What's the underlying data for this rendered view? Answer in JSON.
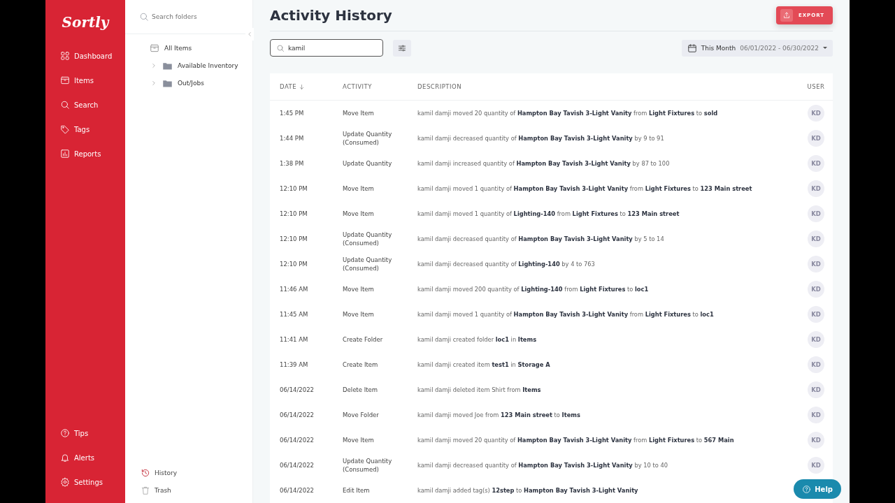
{
  "sidebar": {
    "logo": "Sortly",
    "nav": [
      {
        "label": "Dashboard"
      },
      {
        "label": "Items"
      },
      {
        "label": "Search"
      },
      {
        "label": "Tags"
      },
      {
        "label": "Reports"
      }
    ],
    "bottom_nav": [
      {
        "label": "Tips"
      },
      {
        "label": "Alerts"
      },
      {
        "label": "Settings"
      }
    ]
  },
  "folders": {
    "search": {
      "placeholder": "Search folders"
    },
    "root": {
      "label": "All Items",
      "children": [
        {
          "label": "Available Inventory",
          "expanded": false
        },
        {
          "label": "Out/Jobs",
          "expanded": false
        }
      ]
    },
    "bottom_links": [
      {
        "label": "History",
        "selected": true
      },
      {
        "label": "Trash",
        "selected": false
      }
    ]
  },
  "page": {
    "title": "Activity History",
    "export_button": "EXPORT",
    "search": {
      "value": "kamil"
    },
    "date_range": {
      "label": "This Month",
      "range": "06/01/2022 - 06/30/2022"
    }
  },
  "table": {
    "columns": [
      "DATE",
      "ACTIVITY",
      "DESCRIPTION",
      "USER"
    ],
    "rows": [
      {
        "date": "1:45 PM",
        "activity": "Move Item",
        "description": "kamil damji moved 20 quantity of **Hampton Bay Tavish 3-Light Vanity** from **Light Fixtures** to **sold**",
        "user": "KD"
      },
      {
        "date": "1:44 PM",
        "activity": "Update Quantity (Consumed)",
        "description": "kamil damji decreased quantity of **Hampton Bay Tavish 3-Light Vanity** by 9 to 91",
        "user": "KD"
      },
      {
        "date": "1:38 PM",
        "activity": "Update Quantity",
        "description": "kamil damji increased quantity of **Hampton Bay Tavish 3-Light Vanity** by 87 to 100",
        "user": "KD"
      },
      {
        "date": "12:10 PM",
        "activity": "Move Item",
        "description": "kamil damji moved 1 quantity of **Hampton Bay Tavish 3-Light Vanity** from **Light Fixtures** to **123 Main street**",
        "user": "KD"
      },
      {
        "date": "12:10 PM",
        "activity": "Move Item",
        "description": "kamil damji moved 1 quantity of **Lighting-140** from **Light Fixtures** to **123 Main street**",
        "user": "KD"
      },
      {
        "date": "12:10 PM",
        "activity": "Update Quantity (Consumed)",
        "description": "kamil damji decreased quantity of **Hampton Bay Tavish 3-Light Vanity** by 5 to 14",
        "user": "KD"
      },
      {
        "date": "12:10 PM",
        "activity": "Update Quantity (Consumed)",
        "description": "kamil damji decreased quantity of **Lighting-140** by 4 to 763",
        "user": "KD"
      },
      {
        "date": "11:46 AM",
        "activity": "Move Item",
        "description": "kamil damji moved 200 quantity of **Lighting-140** from **Light Fixtures** to **loc1**",
        "user": "KD"
      },
      {
        "date": "11:45 AM",
        "activity": "Move Item",
        "description": "kamil damji moved 1 quantity of **Hampton Bay Tavish 3-Light Vanity** from **Light Fixtures** to **loc1**",
        "user": "KD"
      },
      {
        "date": "11:41 AM",
        "activity": "Create Folder",
        "description": "kamil damji created folder **loc1** in **Items**",
        "user": "KD"
      },
      {
        "date": "11:39 AM",
        "activity": "Create Item",
        "description": "kamil damji created item **test1** in **Storage A**",
        "user": "KD"
      },
      {
        "date": "06/14/2022",
        "activity": "Delete Item",
        "description": "kamil damji deleted item Shirt from **Items**",
        "user": "KD"
      },
      {
        "date": "06/14/2022",
        "activity": "Move Folder",
        "description": "kamil damji moved Joe from **123 Main street** to **Items**",
        "user": "KD"
      },
      {
        "date": "06/14/2022",
        "activity": "Move Item",
        "description": "kamil damji moved 20 quantity of **Hampton Bay Tavish 3-Light Vanity** from **Light Fixtures** to **567 Main**",
        "user": "KD"
      },
      {
        "date": "06/14/2022",
        "activity": "Update Quantity (Consumed)",
        "description": "kamil damji decreased quantity of **Hampton Bay Tavish 3-Light Vanity** by 10 to 40",
        "user": "KD"
      },
      {
        "date": "06/14/2022",
        "activity": "Edit Item",
        "description": "kamil damji added tag(s) **12step** to **Hampton Bay Tavish 3-Light Vanity**"
      }
    ]
  },
  "help_button": "Help"
}
